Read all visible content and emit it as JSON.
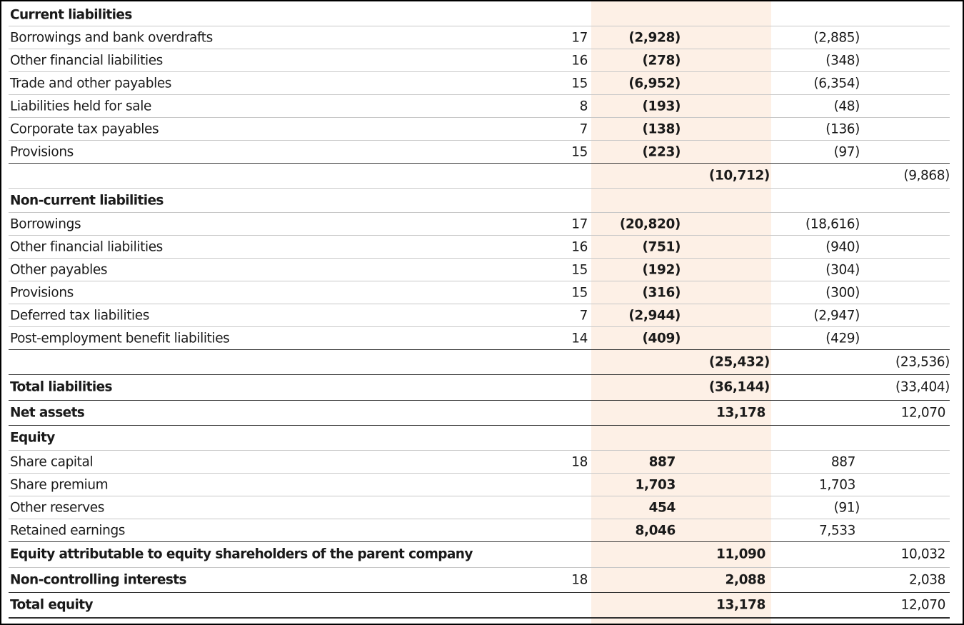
{
  "statement": {
    "rows": [
      {
        "label": "Current liabilities"
      },
      {
        "label": "Borrowings and bank overdrafts",
        "note": "17",
        "cur_item": "(2,928)",
        "prior_item": "(2,885)"
      },
      {
        "label": "Other financial liabilities",
        "note": "16",
        "cur_item": "(278)",
        "prior_item": "(348)"
      },
      {
        "label": "Trade and other payables",
        "note": "15",
        "cur_item": "(6,952)",
        "prior_item": "(6,354)"
      },
      {
        "label": "Liabilities held for sale",
        "note": "8",
        "cur_item": "(193)",
        "prior_item": "(48)"
      },
      {
        "label": "Corporate tax payables",
        "note": "7",
        "cur_item": "(138)",
        "prior_item": "(136)"
      },
      {
        "label": "Provisions",
        "note": "15",
        "cur_item": "(223)",
        "prior_item": "(97)"
      },
      {
        "cur_total": "(10,712)",
        "prior_total": "(9,868)"
      },
      {
        "label": "Non-current liabilities"
      },
      {
        "label": "Borrowings",
        "note": "17",
        "cur_item": "(20,820)",
        "prior_item": "(18,616)"
      },
      {
        "label": "Other financial liabilities",
        "note": "16",
        "cur_item": "(751)",
        "prior_item": "(940)"
      },
      {
        "label": "Other payables",
        "note": "15",
        "cur_item": "(192)",
        "prior_item": "(304)"
      },
      {
        "label": "Provisions",
        "note": "15",
        "cur_item": "(316)",
        "prior_item": "(300)"
      },
      {
        "label": "Deferred tax liabilities",
        "note": "7",
        "cur_item": "(2,944)",
        "prior_item": "(2,947)"
      },
      {
        "label": "Post-employment benefit liabilities",
        "note": "14",
        "cur_item": "(409)",
        "prior_item": "(429)"
      },
      {
        "cur_total": "(25,432)",
        "prior_total": "(23,536)"
      },
      {
        "label": "Total liabilities",
        "cur_total": "(36,144)",
        "prior_total": "(33,404)"
      },
      {
        "label": "Net assets",
        "cur_total": "13,178",
        "prior_total": "12,070"
      },
      {
        "label": "Equity"
      },
      {
        "label": "Share capital",
        "note": "18",
        "cur_item": "887",
        "prior_item": "887"
      },
      {
        "label": "Share premium",
        "cur_item": "1,703",
        "prior_item": "1,703"
      },
      {
        "label": "Other reserves",
        "cur_item": "454",
        "prior_item": "(91)"
      },
      {
        "label": "Retained earnings",
        "cur_item": "8,046",
        "prior_item": "7,533"
      },
      {
        "label": "Equity attributable to equity shareholders of the parent company",
        "cur_total": "11,090",
        "prior_total": "10,032"
      },
      {
        "label": "Non-controlling interests",
        "note": "18",
        "cur_total": "2,088",
        "prior_total": "2,038"
      },
      {
        "label": "Total equity",
        "cur_total": "13,178",
        "prior_total": "12,070"
      }
    ]
  },
  "colors": {
    "current_year_band": "#fdf0e6",
    "text": "#1a1a1a",
    "rule": "#333333"
  }
}
